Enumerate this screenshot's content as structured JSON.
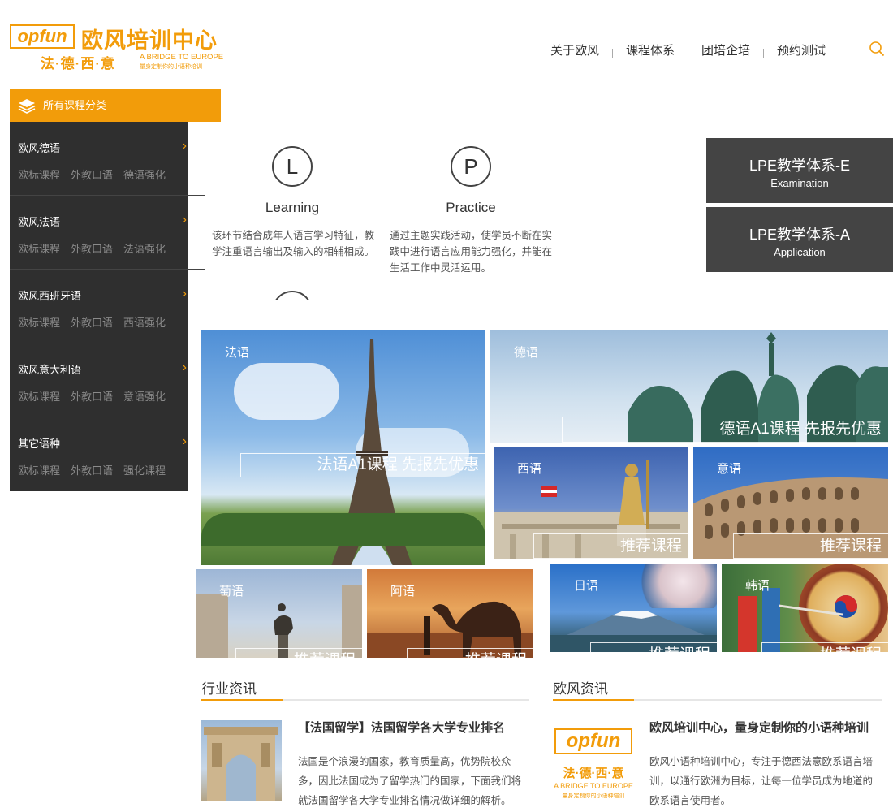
{
  "brand": {
    "logo_mark": "opfun",
    "name": "欧风培训中心",
    "languages": "法·德·西·意",
    "tagline": "A BRIDGE TO EUROPE",
    "slogan": "量身定制你的小语种培训",
    "accent_color": "#f29c0a"
  },
  "nav": {
    "items": [
      "关于欧风",
      "课程体系",
      "团培企培",
      "预约测试"
    ],
    "search_icon": "search-icon"
  },
  "sidebar": {
    "header": "所有课程分类",
    "header_icon": "layers-icon",
    "categories": [
      {
        "title": "欧风德语",
        "subs": [
          "欧标课程",
          "外教口语",
          "德语强化"
        ]
      },
      {
        "title": "欧风法语",
        "subs": [
          "欧标课程",
          "外教口语",
          "法语强化"
        ]
      },
      {
        "title": "欧风西班牙语",
        "subs": [
          "欧标课程",
          "外教口语",
          "西语强化"
        ]
      },
      {
        "title": "欧风意大利语",
        "subs": [
          "欧标课程",
          "外教口语",
          "意语强化"
        ]
      },
      {
        "title": "其它语种",
        "subs": [
          "欧标课程",
          "外教口语",
          "强化课程"
        ]
      }
    ],
    "arrow_icon": "chevron-right-icon"
  },
  "steps": [
    {
      "letter": "L",
      "title": "Learning",
      "desc": "该环节结合成年人语言学习特征，教学注重语言输出及输入的相辅相成。"
    },
    {
      "letter": "P",
      "title": "Practice",
      "desc": "通过主题实践活动，使学员不断在实践中进行语言应用能力强化，并能在生活工作中灵活运用。"
    }
  ],
  "lpe": [
    {
      "title": "LPE教学体系-E",
      "sub": "Examination"
    },
    {
      "title": "LPE教学体系-A",
      "sub": "Application"
    }
  ],
  "tiles": {
    "french": {
      "label": "法语",
      "band": "法语A1课程  先报先优惠"
    },
    "german": {
      "label": "德语",
      "band": "德语A1课程  先报先优惠"
    },
    "spanish": {
      "label": "西语",
      "band": "推荐课程"
    },
    "italian": {
      "label": "意语",
      "band": "推荐课程"
    },
    "portuguese": {
      "label": "萄语",
      "band": "推荐课程"
    },
    "arabic": {
      "label": "阿语",
      "band": "推荐课程"
    },
    "japanese": {
      "label": "日语",
      "band": "推荐课程"
    },
    "korean": {
      "label": "韩语",
      "band": "推荐课程"
    }
  },
  "news": [
    {
      "heading": "行业资讯",
      "title": "【法国留学】法国留学各大学专业排名",
      "text": "法国是个浪漫的国家，教育质量高，优势院校众多，因此法国成为了留学热门的国家，下面我们将就法国留学各大学专业排名情况做详细的解析。"
    },
    {
      "heading": "欧风资讯",
      "title": "欧风培训中心，量身定制你的小语种培训",
      "text": "欧风小语种培训中心，专注于德西法意欧系语言培训，以通行欧洲为目标，让每一位学员成为地道的欧系语言使用者。"
    }
  ]
}
